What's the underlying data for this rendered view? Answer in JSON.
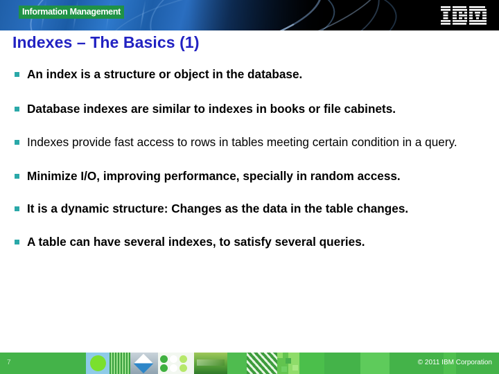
{
  "header": {
    "brand_badge": "Information Management",
    "brand_badge_bg": "#1f9246",
    "logo_name": "IBM",
    "banner_bg": "#000000",
    "banner_accent": "#2a6fc0"
  },
  "title": {
    "text": "Indexes – The Basics (1)",
    "color": "#2222c2"
  },
  "bullets": [
    {
      "text": "An index is a structure or object in the database.",
      "bold": true
    },
    {
      "text": "Database indexes are similar to indexes in books or file cabinets.",
      "bold": true
    },
    {
      "text": "Indexes provide fast access to rows in tables meeting certain condition in a query.",
      "bold": false
    },
    {
      "text": "Minimize I/O, improving performance, specially in random access.",
      "bold": true
    },
    {
      "text": "It is a dynamic structure: Changes as the data in the table changes.",
      "bold": true
    },
    {
      "text": "A table can have several indexes, to satisfy several queries.",
      "bold": true
    }
  ],
  "bullet_marker_color": "#2aa8a8",
  "footer": {
    "page_number": "7",
    "copyright": "© 2011 IBM Corporation",
    "bar_color": "#44b349",
    "text_color": "#ffffff"
  }
}
